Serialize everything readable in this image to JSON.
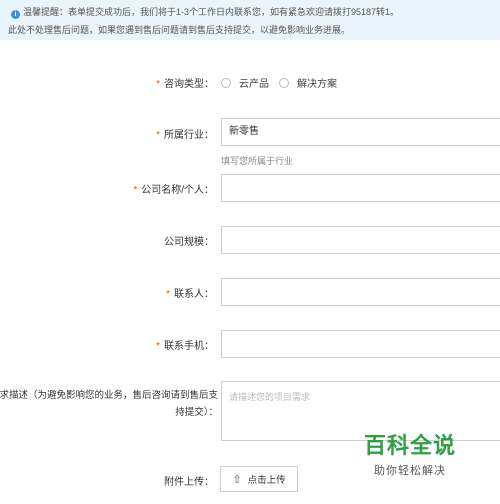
{
  "notice": {
    "line1": "温馨提醒：表单提交成功后，我们将于1-3个工作日内联系您，如有紧急欢迎请拨打95187转1。",
    "line2": "此处不处理售后问题，如果您遇到售后问题请到售后支持提交，以避免影响业务进展。"
  },
  "form": {
    "inquiry_type": {
      "label": "咨询类型：",
      "options": [
        "云产品",
        "解决方案"
      ]
    },
    "industry": {
      "label": "所属行业：",
      "value": "新零售",
      "hint": "填写您所属于行业"
    },
    "company_name": {
      "label": "公司名称/个人：",
      "value": ""
    },
    "company_size": {
      "label": "公司规模：",
      "value": ""
    },
    "contact": {
      "label": "联系人：",
      "value": ""
    },
    "phone": {
      "label": "联系手机：",
      "value": ""
    },
    "description": {
      "label": "需求描述（为避免影响您的业务，售后咨询请到售后支持提交）：",
      "placeholder": "请描述您的项目需求"
    },
    "attachment": {
      "label": "附件上传：",
      "button": "点击上传"
    }
  },
  "watermark": {
    "main": "百科全说",
    "sub": "助你轻松解决"
  },
  "required_mark": "*",
  "colors": {
    "notice_bg": "#eaf4fd",
    "required": "#e8590c",
    "watermark": "#2f9e44"
  },
  "icons": [
    "info-icon",
    "upload-icon"
  ]
}
